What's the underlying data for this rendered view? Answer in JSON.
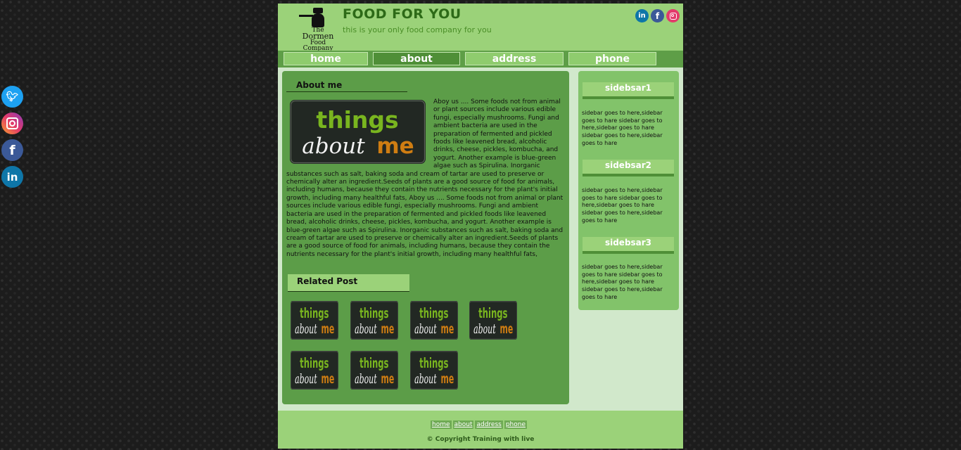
{
  "side_social": {
    "icons": [
      "twitter-icon",
      "instagram-icon",
      "facebook-icon",
      "linkedin-icon"
    ],
    "colors": {
      "twitter": "#1da1f2",
      "instagram": "#e33a6b",
      "facebook": "#3b5998",
      "linkedin": "#0e76a8"
    }
  },
  "header": {
    "logo_text": [
      "The",
      "Dormen",
      "Food Company"
    ],
    "title": "FOOD FOR YOU",
    "tagline": "this is your only food company for you",
    "social_icons": [
      "linkedin-icon",
      "facebook-icon",
      "instagram-icon"
    ]
  },
  "nav": {
    "items": [
      "home",
      "about",
      "address",
      "phone"
    ],
    "active": "about"
  },
  "main": {
    "about_heading": "About me",
    "about_image": {
      "line1": "things",
      "line2a": "about",
      "line2b": "me"
    },
    "about_text": "Aboy us .... Some foods not from animal or plant sources include various edible fungi, especially mushrooms. Fungi and ambient bacteria are used in the preparation of fermented and pickled foods like leavened bread, alcoholic drinks, cheese, pickles, kombucha, and yogurt. Another example is blue-green algae such as Spirulina. Inorganic substances such as salt, baking soda and cream of tartar are used to preserve or chemically alter an ingredient.Seeds of plants are a good source of food for animals, including humans, because they contain the nutrients necessary for the plant's initial growth, including many healthful fats, Aboy us .... Some foods not from animal or plant sources include various edible fungi, especially mushrooms. Fungi and ambient bacteria are used in the preparation of fermented and pickled foods like leavened bread, alcoholic drinks, cheese, pickles, kombucha, and yogurt. Another example is blue-green algae such as Spirulina. Inorganic substances such as salt, baking soda and cream of tartar are used to preserve or chemically alter an ingredient.Seeds of plants are a good source of food for animals, including humans, because they contain the nutrients necessary for the plant's initial growth, including many healthful fats,",
    "related_heading": "Related Post",
    "related_count": 7
  },
  "sidebar": {
    "sections": [
      {
        "title": "sidebsar1",
        "text": "sidebar goes to here,sidebar goes to hare sidebar goes to here,sidebar goes to hare sidebar goes to here,sidebar goes to hare"
      },
      {
        "title": "sidebsar2",
        "text": "sidebar goes to here,sidebar goes to hare sidebar goes to here,sidebar goes to hare sidebar goes to here,sidebar goes to hare"
      },
      {
        "title": "sidebsar3",
        "text": "sidebar goes to here,sidebar goes to hare sidebar goes to here,sidebar goes to hare sidebar goes to here,sidebar goes to hare"
      }
    ]
  },
  "footer": {
    "links": [
      "home",
      "about",
      "address",
      "phone"
    ],
    "copyright": "© Copyright Training with live"
  },
  "colors": {
    "page_bg": "#1c1c1c",
    "header_green": "#9bd279",
    "nav_green": "#5e9e47",
    "content_green": "#5c9d48",
    "sidebar_green": "#82c36a",
    "title_green": "#2d6a17"
  }
}
